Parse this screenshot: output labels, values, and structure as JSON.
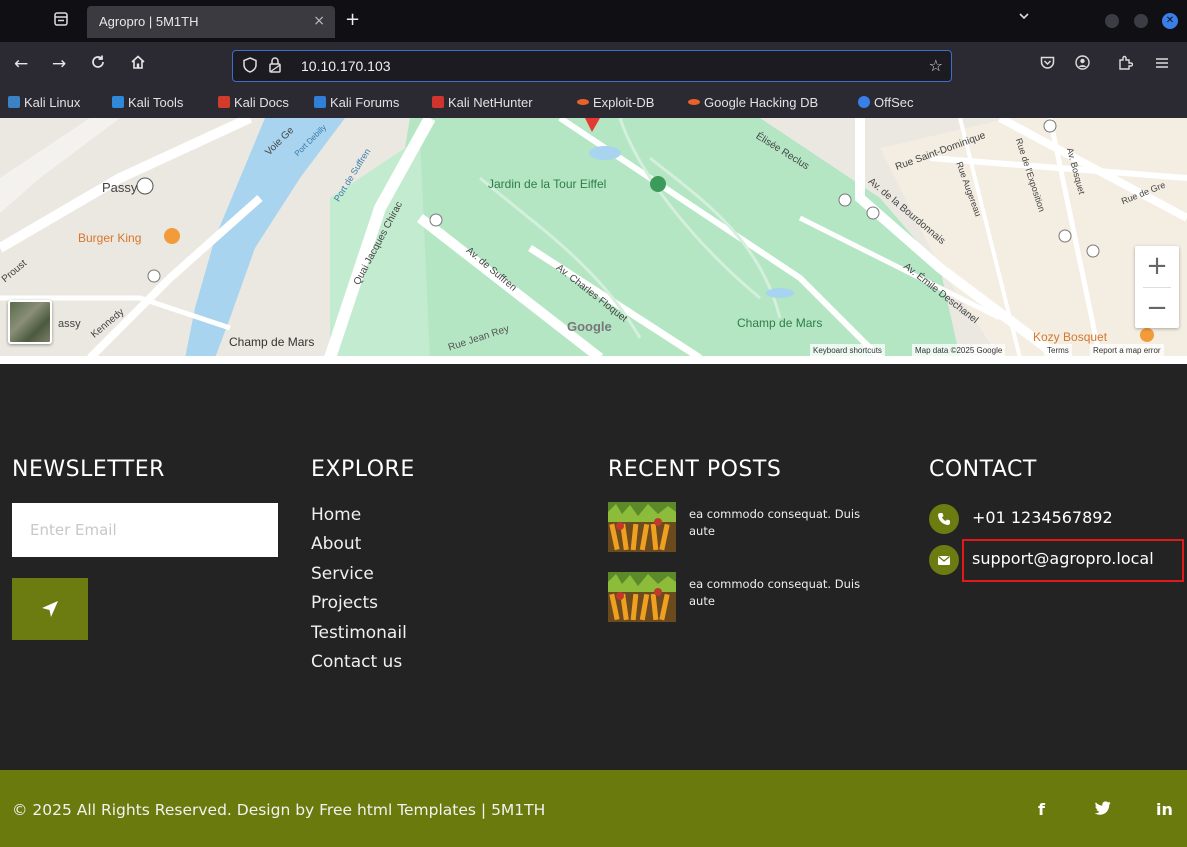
{
  "browser": {
    "tab_title": "Agropro | 5M1TH",
    "tab_close": "×",
    "new_tab": "+",
    "url": "10.10.170.103",
    "bookmarks": [
      {
        "label": "Kali Linux",
        "color": "#3b82c4"
      },
      {
        "label": "Kali Tools",
        "color": "#2f89d8"
      },
      {
        "label": "Kali Docs",
        "color": "#d23a2b"
      },
      {
        "label": "Kali Forums",
        "color": "#2f7ed8"
      },
      {
        "label": "Kali NetHunter",
        "color": "#d0342c"
      },
      {
        "label": "Exploit-DB",
        "color": "#e8622a"
      },
      {
        "label": "Google Hacking DB",
        "color": "#e8622a"
      },
      {
        "label": "OffSec",
        "color": "#3a7ee8"
      }
    ]
  },
  "map": {
    "labels": {
      "passy": "Passy",
      "burger_king": "Burger King",
      "jardin": "Jardin de la Tour Eiffel",
      "champ_de_mars_left": "Champ de Mars",
      "champ_de_mars_right": "Champ de Mars",
      "google": "Google",
      "kozy": "Kozy Bosquet",
      "rue_jean_rey": "Rue Jean Rey",
      "av_suffren": "Av. de Suffren",
      "av_charles": "Av. Charles Floquet",
      "quai": "Quai Jacques Chirac",
      "port_suffren": "Port de Suffren",
      "av_bourdonnais": "Av. de la Bourdonnais",
      "av_emile": "Av. Émile Deschanel",
      "rue_saint_dominique": "Rue Saint-Dominique",
      "rue_augereau": "Rue Augereau",
      "rue_exposition": "Rue de l'Exposition",
      "av_bosquet": "Av. Bosquet",
      "elisee": "Élisée Reclus",
      "voie_ge": "Voie Ge",
      "port_debilly": "Port Debilly",
      "proust": "Proust",
      "kennedy": "Kennedy",
      "assy": "assy",
      "rue_de_gre": "Rue de Gre",
      "champ_mars_small": "Champ de Mars"
    },
    "zoom_in": "+",
    "zoom_out": "−",
    "attribution": {
      "shortcuts": "Keyboard shortcuts",
      "data": "Map data ©2025 Google",
      "terms": "Terms",
      "report": "Report a map error"
    }
  },
  "footer": {
    "newsletter": {
      "title": "NEWSLETTER",
      "placeholder": "Enter Email"
    },
    "explore": {
      "title": "EXPLORE",
      "links": [
        "Home",
        "About",
        "Service",
        "Projects",
        "Testimonail",
        "Contact us"
      ]
    },
    "recent_posts": {
      "title": "RECENT POSTS",
      "posts": [
        {
          "text": "ea commodo consequat. Duis aute"
        },
        {
          "text": "ea commodo consequat. Duis aute"
        }
      ]
    },
    "contact": {
      "title": "CONTACT",
      "phone": "+01 1234567892",
      "email": "support@agropro.local"
    },
    "copyright": "© 2025 All Rights Reserved. Design by Free html Templates | 5M1TH",
    "social": {
      "facebook": "f",
      "twitter": "🐦",
      "linkedin": "in"
    },
    "accent_color": "#6d7c10",
    "highlight_color": "#e01a1a"
  }
}
